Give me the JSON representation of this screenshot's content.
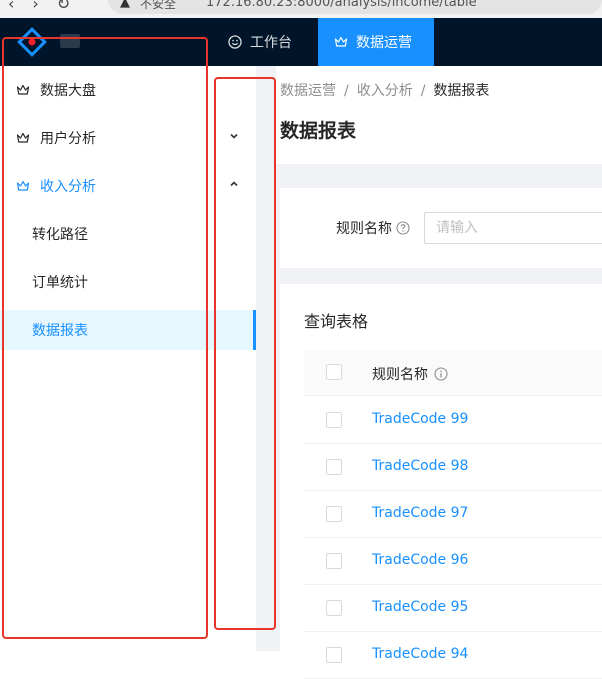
{
  "browser": {
    "insecure_label": "不安全",
    "url": "172.16.80.23:8000/analysis/income/table"
  },
  "topnav": {
    "items": [
      {
        "label": "工作台",
        "icon": "smile-icon"
      },
      {
        "label": "数据运营",
        "icon": "crown-icon"
      }
    ],
    "active_color": "#1890ff",
    "background": "#001529"
  },
  "sidebar": {
    "menu": [
      {
        "label": "数据大盘",
        "icon": "crown-icon"
      },
      {
        "label": "用户分析",
        "icon": "crown-icon",
        "arrow": "chevron-down-icon"
      },
      {
        "label": "收入分析",
        "icon": "crown-icon",
        "arrow": "chevron-up-icon"
      }
    ],
    "submenu": [
      {
        "label": "转化路径"
      },
      {
        "label": "订单统计"
      },
      {
        "label": "数据报表"
      }
    ],
    "selected_color": "#1890ff",
    "selected_bg": "#e6f7ff"
  },
  "breadcrumb": {
    "items": [
      "数据运营",
      "收入分析",
      "数据报表"
    ]
  },
  "page": {
    "title": "数据报表"
  },
  "search": {
    "field_label": "规则名称",
    "placeholder": "请输入"
  },
  "table": {
    "title": "查询表格",
    "column_header": "规则名称",
    "rows": [
      "TradeCode 99",
      "TradeCode 98",
      "TradeCode 97",
      "TradeCode 96",
      "TradeCode 95",
      "TradeCode 94"
    ]
  },
  "annotations": {
    "highlight_color": "#e8352c"
  }
}
